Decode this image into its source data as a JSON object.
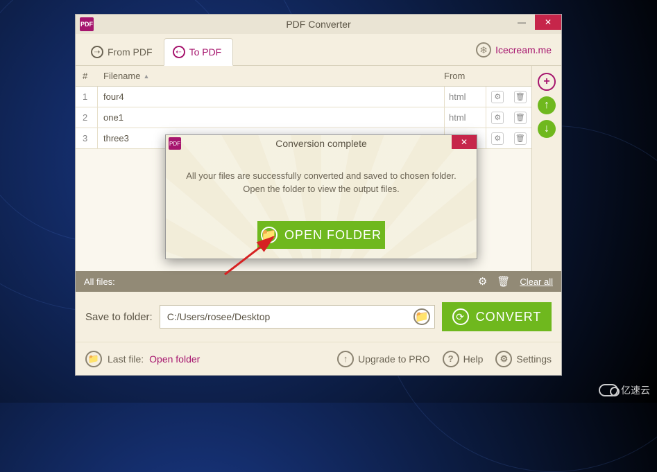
{
  "window": {
    "title": "PDF Converter",
    "tabs": {
      "from": "From PDF",
      "to": "To PDF"
    },
    "brand": "Icecream.me"
  },
  "table": {
    "headers": {
      "num": "#",
      "filename": "Filename",
      "from": "From"
    },
    "rows": [
      {
        "num": "1",
        "name": "four4",
        "from": "html"
      },
      {
        "num": "2",
        "name": "one1",
        "from": "html"
      },
      {
        "num": "3",
        "name": "three3",
        "from": ""
      }
    ]
  },
  "allfiles": {
    "label": "All files:",
    "clear": "Clear all"
  },
  "save": {
    "label": "Save to folder:",
    "path": "C:/Users/rosee/Desktop"
  },
  "convert": "CONVERT",
  "footer": {
    "lastfile_label": "Last file:",
    "lastfile_link": "Open folder",
    "upgrade": "Upgrade to PRO",
    "help": "Help",
    "settings": "Settings"
  },
  "modal": {
    "title": "Conversion complete",
    "line1": "All your files are successfully converted and saved to chosen folder.",
    "line2": "Open the folder to view the output files.",
    "button": "OPEN FOLDER"
  },
  "watermark": "亿速云"
}
